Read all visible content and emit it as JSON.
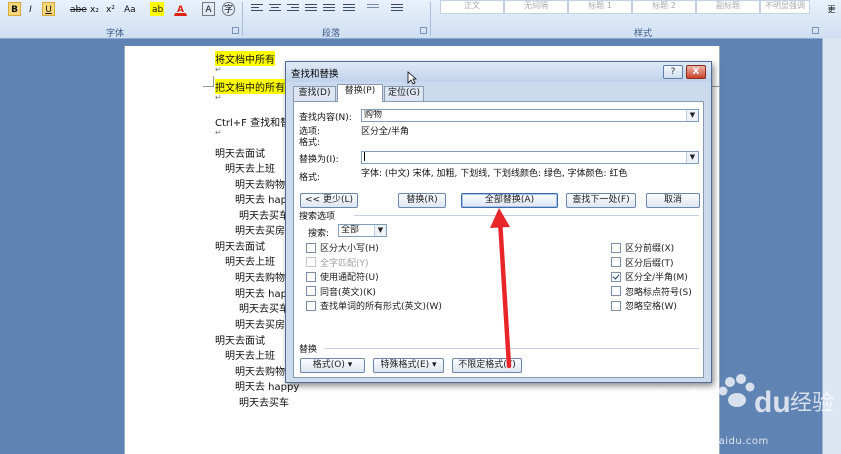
{
  "ribbon": {
    "font_buttons": [
      "B",
      "I",
      "U",
      "abe",
      "x₂",
      "x²",
      "Aa",
      "A"
    ],
    "groups": [
      "字体",
      "段落",
      "样式"
    ],
    "styles": [
      "正文",
      "无间隔",
      "标题 1",
      "标题 2",
      "副标题",
      "不明显强调"
    ],
    "more_label": "更改"
  },
  "document": {
    "lines": [
      {
        "text": "将文档中所有",
        "highlight": true
      },
      {
        "text": "把文档中的所有",
        "highlight": true
      },
      {
        "text": "Ctrl+F   查找和替",
        "highlight": false
      },
      {
        "text": "明天去面试"
      },
      {
        "text": "明天去上班"
      },
      {
        "text": "明天去购物"
      },
      {
        "text": "明天去 happ"
      },
      {
        "text": "明天去买车"
      },
      {
        "text": "明天去买房"
      },
      {
        "text": "明天去面试"
      },
      {
        "text": "明天去上班"
      },
      {
        "text": "明天去购物"
      },
      {
        "text": "明天去 hap"
      },
      {
        "text": "明天去买车"
      },
      {
        "text": "明天去买房"
      },
      {
        "text": "明天去面试"
      },
      {
        "text": "明天去上班"
      },
      {
        "text": "明天去购物"
      },
      {
        "text": "明天去 happy"
      },
      {
        "text": "明天去买车"
      }
    ],
    "para_mark": "↵"
  },
  "dialog": {
    "title": "查找和替换",
    "help_label": "?",
    "close_label": "X",
    "tabs": [
      {
        "label": "查找(D)",
        "active": false
      },
      {
        "label": "替换(P)",
        "active": true
      },
      {
        "label": "定位(G)",
        "active": false
      }
    ],
    "find_label": "查找内容(N):",
    "find_value": "购物",
    "find_options_label": "选项:",
    "find_options_value": "区分全/半角",
    "find_format_label": "格式:",
    "replace_label": "替换为(I):",
    "replace_value": "",
    "replace_format_label": "格式:",
    "replace_format_value": "字体: (中文) 宋体, 加粗, 下划线, 下划线颜色: 绿色, 字体颜色: 红色",
    "buttons": {
      "less": "<< 更少(L)",
      "replace": "替换(R)",
      "replace_all": "全部替换(A)",
      "find_next": "查找下一处(F)",
      "cancel": "取消"
    },
    "search_options_title": "搜索选项",
    "search_label": "搜索:",
    "search_value": "全部",
    "left_options": [
      {
        "label": "区分大小写(H)",
        "checked": false,
        "disabled": false
      },
      {
        "label": "全字匹配(Y)",
        "checked": false,
        "disabled": true
      },
      {
        "label": "使用通配符(U)",
        "checked": false,
        "disabled": false
      },
      {
        "label": "同音(英文)(K)",
        "checked": false,
        "disabled": false
      },
      {
        "label": "查找单词的所有形式(英文)(W)",
        "checked": false,
        "disabled": false
      }
    ],
    "right_options": [
      {
        "label": "区分前缀(X)",
        "checked": false
      },
      {
        "label": "区分后缀(T)",
        "checked": false
      },
      {
        "label": "区分全/半角(M)",
        "checked": true
      },
      {
        "label": "忽略标点符号(S)",
        "checked": false
      },
      {
        "label": "忽略空格(W)",
        "checked": false
      }
    ],
    "replace_section_title": "替换",
    "replace_buttons": {
      "format": "格式(O)",
      "special": "特殊格式(E)",
      "no_format": "不限定格式(T)"
    }
  },
  "watermark": {
    "brand": "Baidu经验",
    "url": "jingyan.baidu.com"
  },
  "colors": {
    "highlight": "#ffff00",
    "arrow": "#e8262a",
    "background": "#5f83b3"
  }
}
